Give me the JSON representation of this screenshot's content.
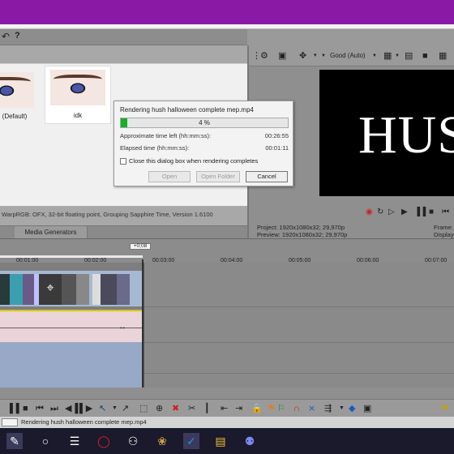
{
  "menubar": {
    "undo_icon": "undo-icon",
    "help_label": "?"
  },
  "media_thumbs": [
    {
      "label": "(Default)"
    },
    {
      "label": "idk"
    }
  ],
  "plugin_status": "WarpRGB: OFX, 32-bit floating point, Grouping  Sapphire Time, Version 1.6100",
  "tabs": {
    "media_generators": "Media Generators"
  },
  "preview": {
    "quality": "Good (Auto)",
    "screen_text": "HUS",
    "project_label": "Project:",
    "project_value": "1920x1080x32; 29,970p",
    "preview_label": "Preview:",
    "preview_value": "1920x1080x32; 29,970p",
    "frame_label": "Frame:",
    "display_label": "Display"
  },
  "dialog": {
    "title": "Rendering hush halloween complete mep.mp4",
    "progress_percent": 4,
    "progress_text": "4 %",
    "time_left_label": "Approximate time left (hh:mm:ss):",
    "time_left_value": "00:26:55",
    "elapsed_label": "Elapsed time (hh:mm:ss):",
    "elapsed_value": "00:01:11",
    "close_checkbox": "Close this dialog box when rendering completes",
    "open_button": "Open",
    "open_folder_button": "Open Folder",
    "cancel_button": "Cancel"
  },
  "timeline": {
    "cursor_label": "+0;08",
    "ticks": [
      "00:01:00",
      "00:02:00",
      "00:03:00",
      "00:04:00",
      "00:05:00",
      "00:06:00",
      "00:07:00"
    ]
  },
  "statusbar": {
    "text": "Rendering hush halloween complete mep.mp4"
  },
  "colors": {
    "titlebar": "#8a1aa6",
    "progress_fill": "#16b02a",
    "video_track": "#a7b9d1",
    "audio_track": "#ead4d9"
  }
}
